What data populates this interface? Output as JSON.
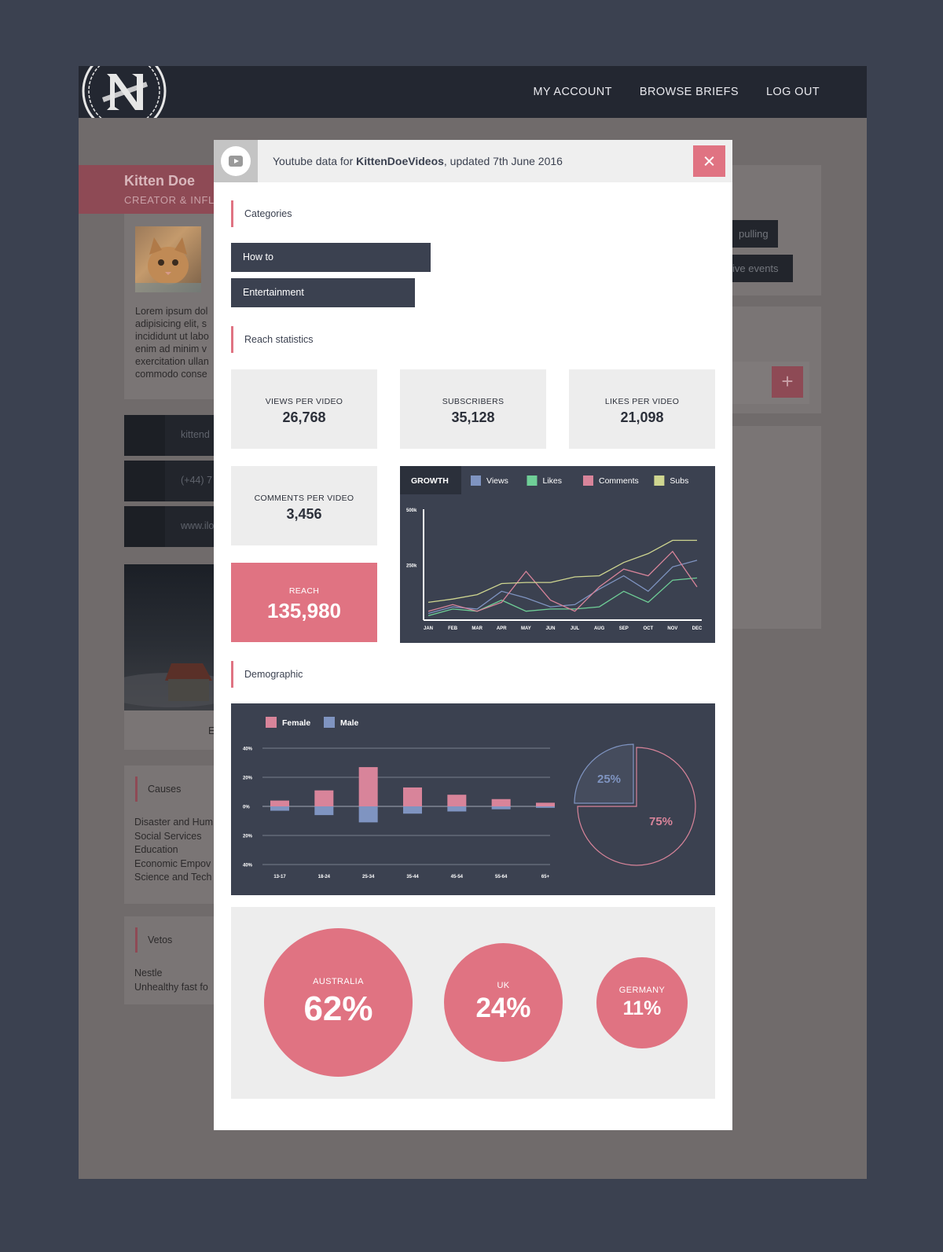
{
  "nav": {
    "items": [
      "MY ACCOUNT",
      "BROWSE BRIEFS",
      "LOG OUT"
    ]
  },
  "background": {
    "name": "Kitten Doe",
    "role": "CREATOR & INFL",
    "bio": [
      "Lorem ipsum dol",
      "adipisicing elit, s",
      "incididunt ut labo",
      "enim ad minim v",
      "exercitation ullan",
      "commodo conse"
    ],
    "contacts": [
      "kittend",
      "(+44) 7",
      "www.ilo"
    ],
    "image_caption": "E",
    "causes_title": "Causes",
    "causes": [
      "Disaster and Hum",
      "Social Services",
      "Education",
      "Economic Empov",
      "Science and Tech"
    ],
    "vetos_title": "Vetos",
    "vetos": [
      "Nestle",
      "Unhealthy fast fo"
    ],
    "tags": [
      "pulling",
      "ive events"
    ],
    "plus": "+"
  },
  "modal": {
    "title_prefix": "Youtube data for ",
    "channel": "KittenDoeVideos",
    "title_suffix": ", updated 7th June 2016",
    "icons": {
      "youtube": "youtube-icon",
      "close": "close-icon"
    },
    "categories_title": "Categories",
    "categories": [
      "How to",
      "Entertainment"
    ],
    "reach_title": "Reach statistics",
    "stats": {
      "views": {
        "label": "VIEWS PER VIDEO",
        "value": "26,768"
      },
      "subscribers": {
        "label": "SUBSCRIBERS",
        "value": "35,128"
      },
      "likes": {
        "label": "LIKES PER VIDEO",
        "value": "21,098"
      },
      "comments": {
        "label": "COMMENTS PER VIDEO",
        "value": "3,456"
      },
      "reach": {
        "label": "REACH",
        "value": "135,980"
      }
    },
    "demographic_title": "Demographic",
    "geo": [
      {
        "country": "AUSTRALIA",
        "pct": "62%"
      },
      {
        "country": "UK",
        "pct": "24%"
      },
      {
        "country": "GERMANY",
        "pct": "11%"
      }
    ]
  },
  "colors": {
    "accent": "#e07382",
    "panel": "#3b4150",
    "views": "#7f94c1",
    "likes": "#6fcf97",
    "comments": "#d8849a",
    "subs": "#cfd690"
  },
  "chart_data": [
    {
      "type": "line",
      "title": "GROWTH",
      "x": [
        "JAN",
        "FEB",
        "MAR",
        "APR",
        "MAY",
        "JUN",
        "JUL",
        "AUG",
        "SEP",
        "OCT",
        "NOV",
        "DEC"
      ],
      "yticks": [
        "500k",
        "250k"
      ],
      "ylim": [
        0,
        500000
      ],
      "series": [
        {
          "name": "Views",
          "color": "#7f94c1",
          "values": [
            30000,
            60000,
            50000,
            130000,
            100000,
            60000,
            70000,
            140000,
            200000,
            130000,
            240000,
            270000
          ]
        },
        {
          "name": "Likes",
          "color": "#6fcf97",
          "values": [
            20000,
            50000,
            40000,
            90000,
            40000,
            50000,
            50000,
            60000,
            130000,
            80000,
            180000,
            190000
          ]
        },
        {
          "name": "Comments",
          "color": "#d8849a",
          "values": [
            40000,
            70000,
            40000,
            80000,
            220000,
            90000,
            40000,
            150000,
            230000,
            200000,
            310000,
            150000
          ]
        },
        {
          "name": "Subs",
          "color": "#cfd690",
          "values": [
            80000,
            95000,
            115000,
            165000,
            170000,
            170000,
            195000,
            200000,
            260000,
            300000,
            360000,
            360000
          ]
        }
      ],
      "grid": false,
      "legend": "top"
    },
    {
      "type": "bar",
      "categories": [
        "13-17",
        "18-24",
        "25-34",
        "35-44",
        "45-54",
        "55-64",
        "65+"
      ],
      "yticks": [
        "40%",
        "20%",
        "0%",
        "20%",
        "40%"
      ],
      "ylim": [
        -40,
        40
      ],
      "series": [
        {
          "name": "Female",
          "color": "#d8849a",
          "values": [
            4,
            11,
            27,
            13,
            8,
            5,
            2.5
          ]
        },
        {
          "name": "Male",
          "color": "#7f94c1",
          "values": [
            -3,
            -6,
            -11,
            -5,
            -3.5,
            -2,
            -1
          ]
        }
      ],
      "grid": true,
      "legend": "top-left"
    },
    {
      "type": "pie",
      "labels": [
        "25%",
        "75%"
      ],
      "values": [
        25,
        75
      ],
      "colors": [
        "#7f94c1",
        "#d8849a"
      ]
    }
  ]
}
